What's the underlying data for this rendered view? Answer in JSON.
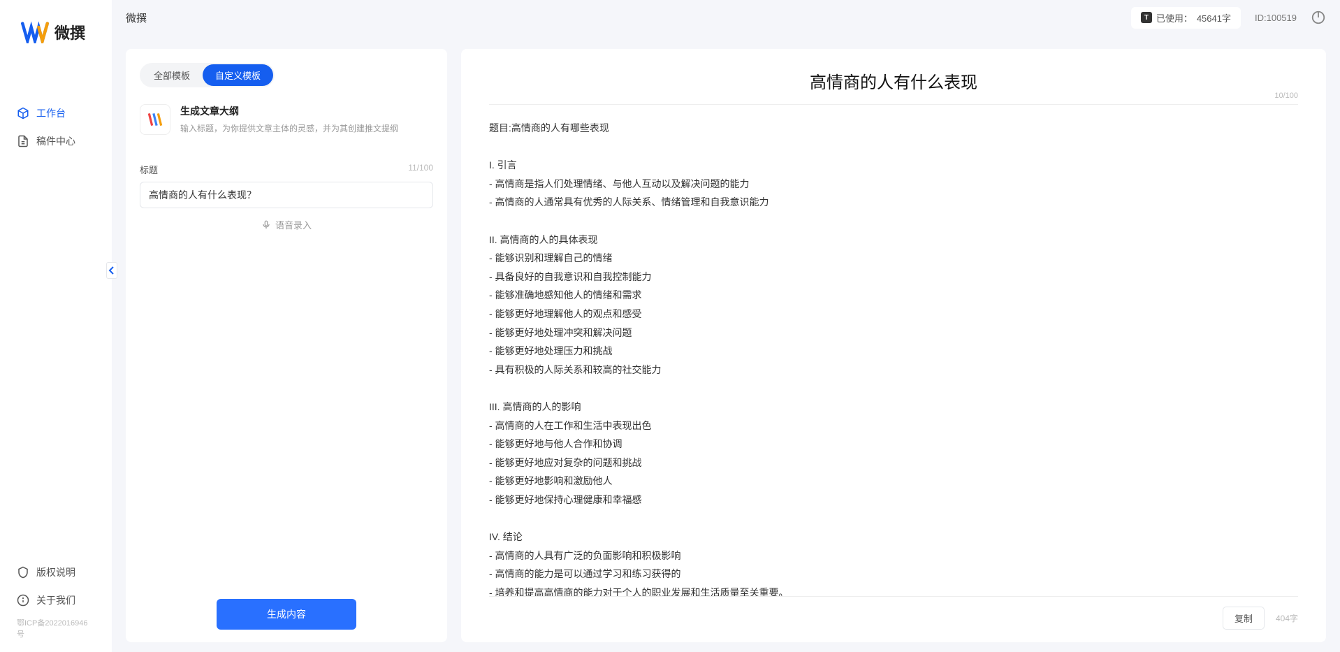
{
  "brand": {
    "name": "微撰"
  },
  "topbar": {
    "title": "微撰",
    "usage_label": "已使用：",
    "usage_value": "45641字",
    "userid_label": "ID:",
    "userid_value": "100519"
  },
  "sidebar": {
    "nav": [
      {
        "label": "工作台",
        "icon": "cube-icon",
        "active": true
      },
      {
        "label": "稿件中心",
        "icon": "doc-icon",
        "active": false
      }
    ],
    "bottom": [
      {
        "label": "版权说明",
        "icon": "shield-icon"
      },
      {
        "label": "关于我们",
        "icon": "info-icon"
      }
    ],
    "icp": "鄂ICP备2022016946号"
  },
  "tabs": {
    "all": "全部模板",
    "custom": "自定义模板"
  },
  "template": {
    "title": "生成文章大纲",
    "desc": "输入标题，为你提供文章主体的灵感，并为其创建推文提纲"
  },
  "form": {
    "title_label": "标题",
    "title_count": "11/100",
    "title_value": "高情商的人有什么表现？",
    "voice_hint": "语音录入",
    "generate": "生成内容"
  },
  "output": {
    "title": "高情商的人有什么表现",
    "title_count": "10/100",
    "body": "题目:高情商的人有哪些表现\n\nI. 引言\n- 高情商是指人们处理情绪、与他人互动以及解决问题的能力\n- 高情商的人通常具有优秀的人际关系、情绪管理和自我意识能力\n\nII. 高情商的人的具体表现\n- 能够识别和理解自己的情绪\n- 具备良好的自我意识和自我控制能力\n- 能够准确地感知他人的情绪和需求\n- 能够更好地理解他人的观点和感受\n- 能够更好地处理冲突和解决问题\n- 能够更好地处理压力和挑战\n- 具有积极的人际关系和较高的社交能力\n\nIII. 高情商的人的影响\n- 高情商的人在工作和生活中表现出色\n- 能够更好地与他人合作和协调\n- 能够更好地应对复杂的问题和挑战\n- 能够更好地影响和激励他人\n- 能够更好地保持心理健康和幸福感\n\nIV. 结论\n- 高情商的人具有广泛的负面影响和积极影响\n- 高情商的能力是可以通过学习和练习获得的\n- 培养和提高高情商的能力对于个人的职业发展和生活质量至关重要。",
    "copy": "复制",
    "word_count": "404字"
  }
}
